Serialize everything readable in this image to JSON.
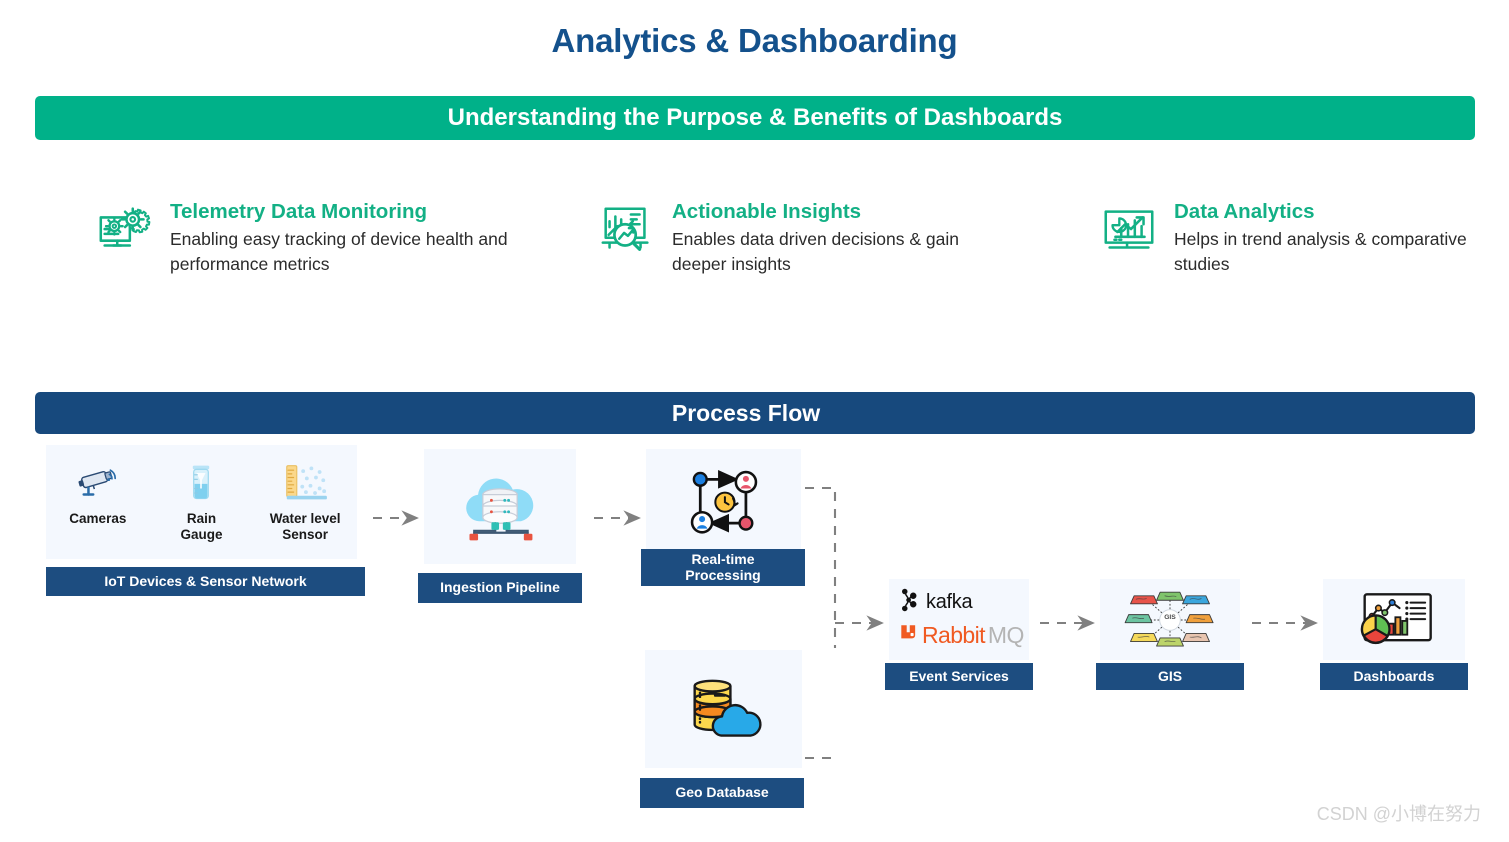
{
  "page": {
    "title": "Analytics & Dashboarding",
    "watermark": "CSDN @小博在努力"
  },
  "colors": {
    "title_blue": "#14518c",
    "banner_green": "#00b189",
    "banner_blue": "#17497d",
    "label_blue": "#1d4d80",
    "feature_green": "#13b085",
    "card_bg": "#f4f8fe",
    "connector_gray": "#808080",
    "rabbit_orange": "#f05a22",
    "rabbit_gray": "#b4b4b4",
    "watermark_gray": "#d2d2d2"
  },
  "green_banner": {
    "text": "Understanding the Purpose & Benefits of Dashboards"
  },
  "features": [
    {
      "icon": "monitor-gears-icon",
      "title": "Telemetry Data Monitoring",
      "description": "Enabling easy tracking of device health and performance metrics"
    },
    {
      "icon": "report-magnifier-icon",
      "title": "Actionable Insights",
      "description": "Enables data driven decisions & gain deeper insights"
    },
    {
      "icon": "monitor-charts-icon",
      "title": "Data Analytics",
      "description": "Helps in trend analysis  & comparative studies"
    }
  ],
  "flow_banner": {
    "text": "Process Flow"
  },
  "flow": {
    "nodes": [
      {
        "id": "iot",
        "label": "IoT Devices & Sensor Network",
        "devices": [
          {
            "icon": "security-camera-icon",
            "name": "Cameras"
          },
          {
            "icon": "rain-gauge-icon",
            "name": "Rain\nGauge"
          },
          {
            "icon": "water-level-sensor-icon",
            "name": "Water level\nSensor"
          }
        ]
      },
      {
        "id": "ingestion",
        "label": "Ingestion Pipeline",
        "icon": "cloud-database-icon"
      },
      {
        "id": "realtime",
        "label": "Real-time\nProcessing",
        "icon": "realtime-cycle-icon"
      },
      {
        "id": "geodb",
        "label": "Geo Database",
        "icon": "database-cloud-icon"
      },
      {
        "id": "events",
        "label": "Event Services",
        "brands": [
          {
            "icon": "kafka-logo-icon",
            "text": "kafka"
          },
          {
            "icon": "rabbitmq-logo-icon",
            "text_primary": "Rabbit",
            "text_secondary": "MQ"
          }
        ]
      },
      {
        "id": "gis",
        "label": "GIS",
        "icon": "gis-layers-icon",
        "icon_caption": "GIS"
      },
      {
        "id": "dash",
        "label": "Dashboards",
        "icon": "dashboard-charts-icon"
      }
    ],
    "device_names_split": {
      "cameras": [
        "Cameras"
      ],
      "rain_gauge": [
        "Rain",
        "Gauge"
      ],
      "water_level": [
        "Water level",
        "Sensor"
      ]
    },
    "realtime_label_lines": [
      "Real-time",
      "Processing"
    ],
    "connections": [
      {
        "from": "iot",
        "to": "ingestion",
        "style": "dashed-arrow"
      },
      {
        "from": "ingestion",
        "to": "realtime",
        "style": "dashed-arrow"
      },
      {
        "from": "realtime",
        "to": "events",
        "style": "dashed-elbow"
      },
      {
        "from": "geodb",
        "to": "events",
        "style": "dashed-elbow"
      },
      {
        "from": "events",
        "to": "gis",
        "style": "dashed-arrow"
      },
      {
        "from": "gis",
        "to": "dash",
        "style": "dashed-arrow"
      }
    ]
  }
}
